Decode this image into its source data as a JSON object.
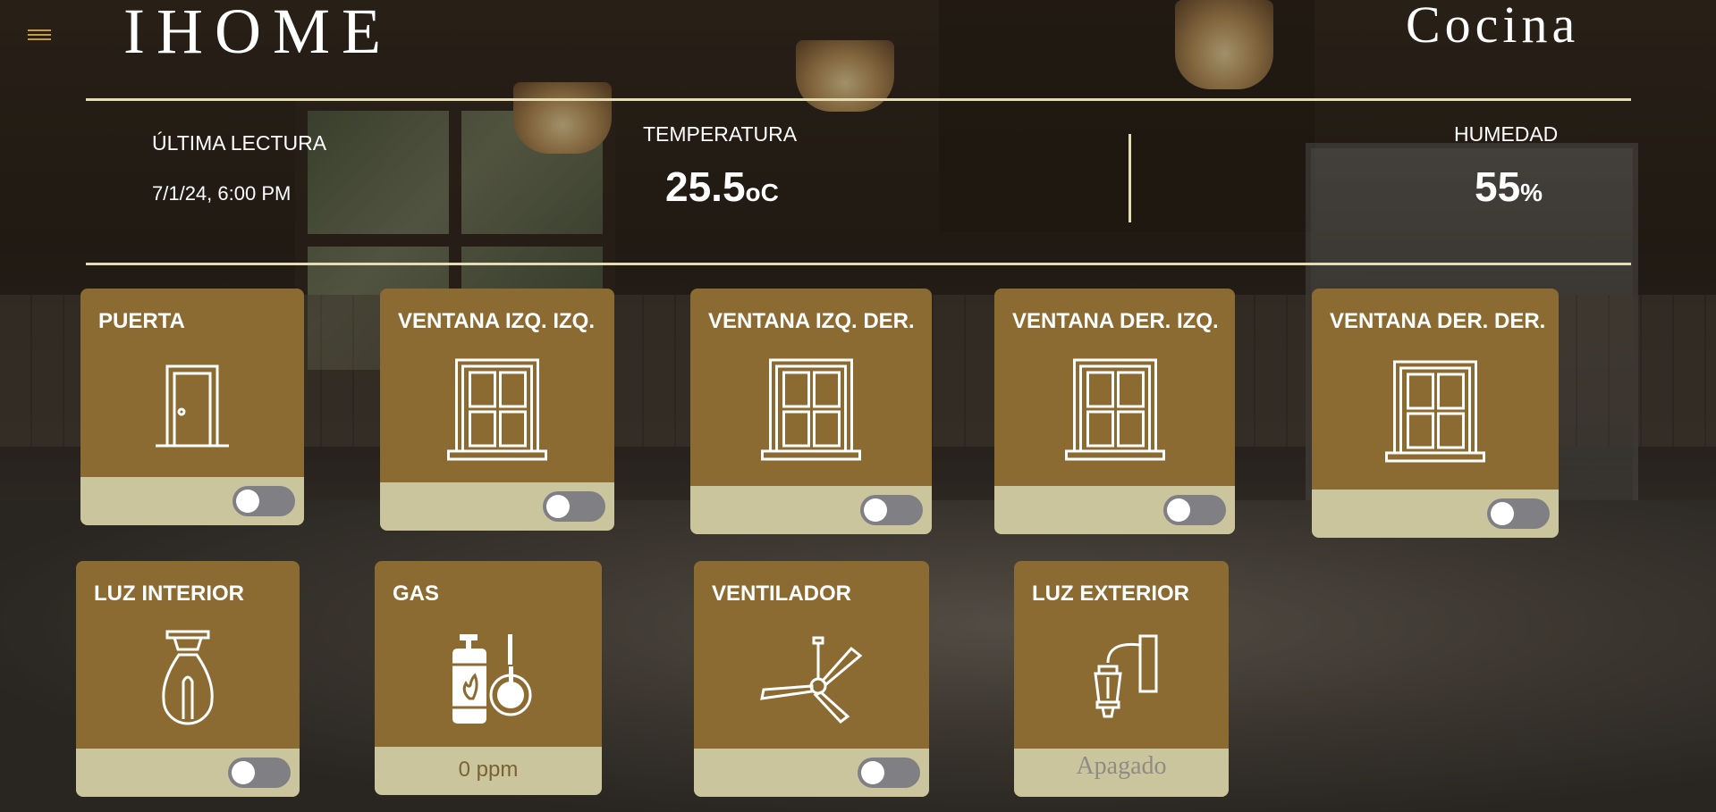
{
  "brand": "IHOME",
  "room": "Cocina",
  "reading": {
    "label": "ÚLTIMA LECTURA",
    "value": "7/1/24, 6:00 PM"
  },
  "temperature": {
    "label": "TEMPERATURA",
    "value": "25.5",
    "unit": "oC"
  },
  "humidity": {
    "label": "HUMEDAD",
    "value": "55",
    "unit": "%"
  },
  "devices": [
    {
      "title": "PUERTA",
      "icon": "door-icon",
      "control": "toggle",
      "on": false
    },
    {
      "title": "VENTANA IZQ. IZQ.",
      "icon": "window-icon",
      "control": "toggle",
      "on": false
    },
    {
      "title": "VENTANA IZQ. DER.",
      "icon": "window-icon",
      "control": "toggle",
      "on": false
    },
    {
      "title": "VENTANA DER. IZQ.",
      "icon": "window-icon",
      "control": "toggle",
      "on": false
    },
    {
      "title": "VENTANA DER. DER.",
      "icon": "window-icon",
      "control": "toggle",
      "on": false
    },
    {
      "title": "LUZ INTERIOR",
      "icon": "light-bulb-icon",
      "control": "toggle",
      "on": false
    },
    {
      "title": "GAS",
      "icon": "gas-cylinder-icon",
      "control": "reading",
      "reading": "0 ppm"
    },
    {
      "title": "VENTILADOR",
      "icon": "ceiling-fan-icon",
      "control": "toggle",
      "on": false
    },
    {
      "title": "LUZ EXTERIOR",
      "icon": "wall-lantern-icon",
      "control": "status",
      "status": "Apagado"
    }
  ],
  "colors": {
    "card": "#8c6b33",
    "card_footer": "#cac59d",
    "rule": "#e6dcb4",
    "menu": "#c99b3e",
    "toggle_off": "#7f7f84"
  }
}
